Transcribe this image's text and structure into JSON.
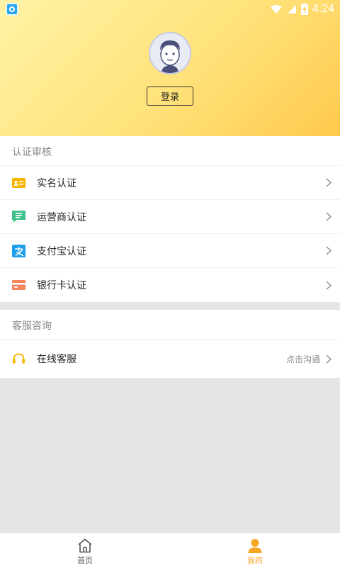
{
  "status_bar": {
    "time": "4:24"
  },
  "header": {
    "login_label": "登录"
  },
  "verification": {
    "title": "认证审核",
    "items": [
      {
        "label": "实名认证",
        "icon": "id-card-icon",
        "color": "#f7b500"
      },
      {
        "label": "运营商认证",
        "icon": "chat-list-icon",
        "color": "#3cc28a"
      },
      {
        "label": "支付宝认证",
        "icon": "alipay-icon",
        "color": "#1e9ee8"
      },
      {
        "label": "银行卡认证",
        "icon": "bank-card-icon",
        "color": "#f4835e"
      }
    ]
  },
  "support": {
    "title": "客服咨询",
    "items": [
      {
        "label": "在线客服",
        "hint": "点击沟通",
        "icon": "headset-icon",
        "color": "#f7b500"
      }
    ]
  },
  "tabbar": {
    "tabs": [
      {
        "label": "首页",
        "icon": "home-icon",
        "active": false
      },
      {
        "label": "我的",
        "icon": "user-icon",
        "active": true
      }
    ],
    "active_color": "#f5a623",
    "inactive_color": "#555555"
  }
}
